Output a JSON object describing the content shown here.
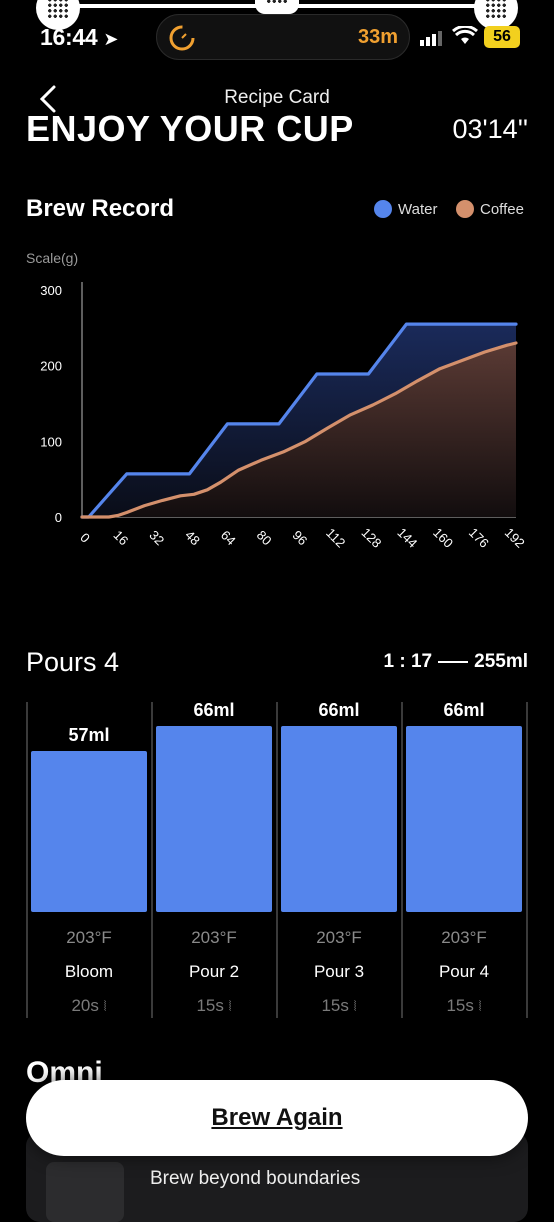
{
  "status_bar": {
    "time": "16:44",
    "activity_time": "33m",
    "battery": "56"
  },
  "header": {
    "subtitle": "Recipe Card",
    "title": "ENJOY YOUR CUP",
    "total_time": "03'14''"
  },
  "brew_record": {
    "title": "Brew Record",
    "legend_water": "Water",
    "legend_coffee": "Coffee",
    "colors": {
      "water": "#5585ec",
      "coffee": "#d4906c"
    }
  },
  "chart_data": {
    "type": "area",
    "title": "",
    "xlabel": "",
    "ylabel": "Scale(g)",
    "ylim": [
      0,
      300
    ],
    "yticks": [
      0,
      100,
      200,
      300
    ],
    "xticks": [
      0,
      16,
      32,
      48,
      64,
      80,
      96,
      112,
      128,
      144,
      160,
      176,
      192
    ],
    "xlim": [
      0,
      194
    ],
    "series": [
      {
        "name": "Water",
        "x": [
          0,
          3,
          20,
          48,
          65,
          88,
          105,
          128,
          145,
          194
        ],
        "y": [
          0,
          0,
          57,
          57,
          123,
          123,
          189,
          189,
          255,
          255
        ]
      },
      {
        "name": "Coffee",
        "x": [
          0,
          12,
          16,
          20,
          28,
          36,
          44,
          50,
          56,
          62,
          70,
          80,
          90,
          100,
          110,
          120,
          130,
          140,
          150,
          160,
          170,
          180,
          190,
          194
        ],
        "y": [
          0,
          0,
          2,
          6,
          15,
          22,
          28,
          30,
          36,
          46,
          62,
          75,
          86,
          100,
          118,
          135,
          148,
          163,
          180,
          196,
          207,
          218,
          227,
          230
        ]
      }
    ]
  },
  "pours": {
    "title": "Pours 4",
    "ratio": "1 : 17",
    "total": "255ml",
    "items": [
      {
        "volume": "57ml",
        "value": 57,
        "temp": "203°F",
        "name": "Bloom",
        "duration": "20s"
      },
      {
        "volume": "66ml",
        "value": 66,
        "temp": "203°F",
        "name": "Pour 2",
        "duration": "15s"
      },
      {
        "volume": "66ml",
        "value": 66,
        "temp": "203°F",
        "name": "Pour 3",
        "duration": "15s"
      },
      {
        "volume": "66ml",
        "value": 66,
        "temp": "203°F",
        "name": "Pour 4",
        "duration": "15s"
      }
    ]
  },
  "bottom": {
    "section_title": "Omni",
    "promo_text": "Brew beyond boundaries",
    "cta": "Brew Again"
  }
}
